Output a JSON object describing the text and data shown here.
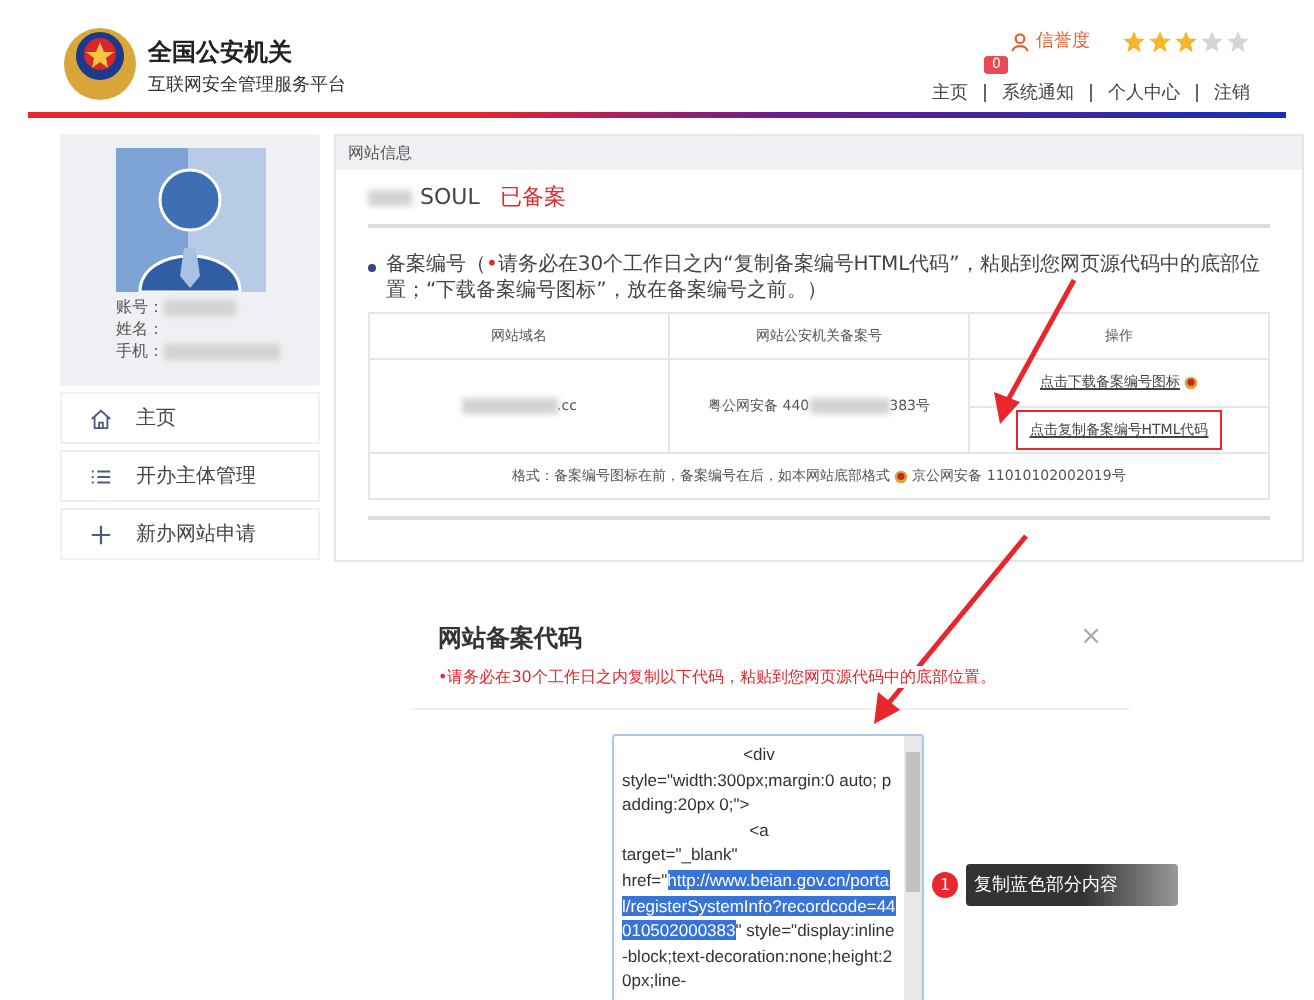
{
  "header": {
    "title": "全国公安机关",
    "subtitle": "互联网安全管理服务平台",
    "reputation_label": "信誉度",
    "stars": 3,
    "badge": "0",
    "nav": [
      "主页",
      "系统通知",
      "个人中心",
      "注销"
    ]
  },
  "profile": {
    "fields": [
      {
        "label": "账号："
      },
      {
        "label": "姓名："
      },
      {
        "label": "手机："
      }
    ]
  },
  "menu": [
    {
      "kind": "home",
      "label": "主页"
    },
    {
      "kind": "list",
      "label": "开办主体管理"
    },
    {
      "kind": "add",
      "label": "新办网站申请"
    }
  ],
  "panel": {
    "title": "网站信息",
    "site_name": "SOUL",
    "status": "已备案",
    "notice": {
      "prefix": "备案编号（",
      "mark": "•",
      "text": "请务必在30个工作日之内“复制备案编号HTML代码”，粘贴到您网页源代码中的底部位置；“下载备案编号图标”，放在备案编号之前。）"
    },
    "table": {
      "columns": [
        "网站域名",
        "网站公安机关备案号",
        "操作"
      ],
      "row": {
        "domain_suffix": ".cc",
        "record_prefix": "粤公网安备 440",
        "record_suffix": "383号",
        "download_link": "点击下载备案编号图标",
        "copy_link": "点击复制备案编号HTML代码"
      },
      "footer": {
        "text": "格式：备案编号图标在前，备案编号在后，如本网站底部格式",
        "example": "京公网安备 11010102002019号"
      }
    }
  },
  "dialog": {
    "title": "网站备案代码",
    "note": "•请务必在30个工作日之内复制以下代码，粘贴到您网页源代码中的底部位置。",
    "close": "×",
    "code": [
      {
        "kind": "tag",
        "parts": [
          {
            "text": "<div",
            "selected": false
          }
        ]
      },
      {
        "kind": "attrs",
        "parts": [
          {
            "text": "style=\"width:300px;margin:0 auto; padding:20px 0;\">",
            "selected": false
          }
        ]
      },
      {
        "kind": "tag",
        "parts": [
          {
            "text": "<a",
            "selected": false
          }
        ]
      },
      {
        "kind": "attrs",
        "parts": [
          {
            "text": "target=\"_blank\"",
            "selected": false
          }
        ]
      },
      {
        "kind": "attrs",
        "parts": [
          {
            "text": "href=\"",
            "selected": false
          },
          {
            "text": "http://www.beian.gov.cn/portal/registerSystemInfo?recordcode=44010502000383",
            "selected": true
          },
          {
            "text": "\" style=\"display:inline-block;text-decoration:none;height:20px;line-",
            "selected": false
          }
        ]
      }
    ]
  },
  "tooltip": {
    "number": "1",
    "text": "复制蓝色部分内容"
  }
}
